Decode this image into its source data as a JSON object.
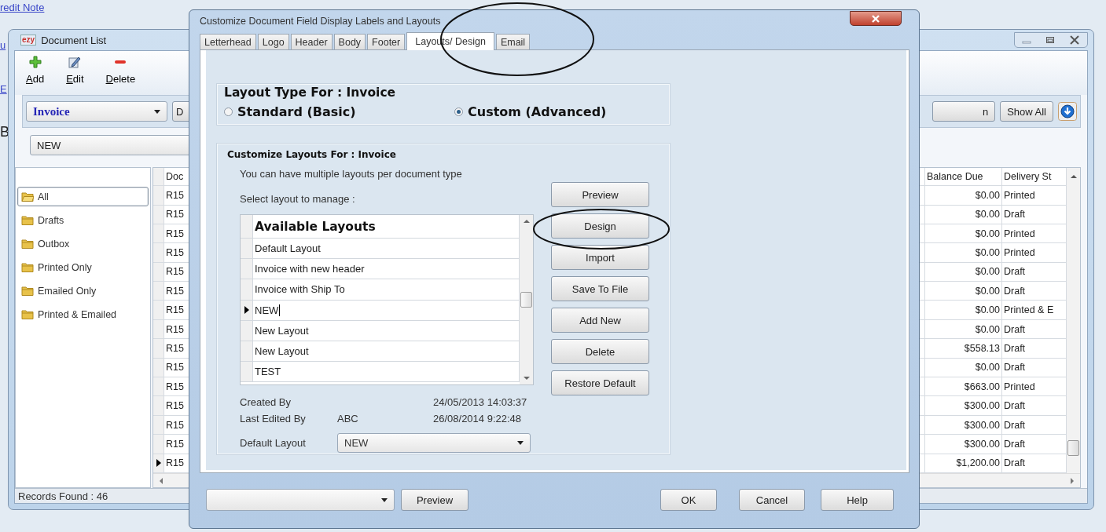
{
  "background_fragments": [
    "redit Note",
    "u",
    "E",
    "B"
  ],
  "document_list": {
    "logo": "ezy",
    "title": "Document List",
    "toolbar": [
      {
        "label": "Add"
      },
      {
        "label": "Edit"
      },
      {
        "label": "Delete"
      }
    ],
    "document_type": "Invoice",
    "left_button": "D",
    "right_button": "n",
    "show_all": "Show All",
    "layout_filter": "NEW",
    "folders": [
      {
        "label": "All",
        "selected": true
      },
      {
        "label": "Drafts",
        "selected": false
      },
      {
        "label": "Outbox",
        "selected": false
      },
      {
        "label": "Printed Only",
        "selected": false
      },
      {
        "label": "Emailed Only",
        "selected": false
      },
      {
        "label": "Printed & Emailed",
        "selected": false
      }
    ],
    "table": {
      "columns": {
        "doc": "Doc",
        "balance_due": "Balance Due",
        "delivery_status": "Delivery St"
      },
      "rows": [
        {
          "doc": "R15",
          "balance_due": "$0.00",
          "delivery_status": "Printed",
          "current": false
        },
        {
          "doc": "R15",
          "balance_due": "$0.00",
          "delivery_status": "Draft",
          "current": false
        },
        {
          "doc": "R15",
          "balance_due": "$0.00",
          "delivery_status": "Printed",
          "current": false
        },
        {
          "doc": "R15",
          "balance_due": "$0.00",
          "delivery_status": "Printed",
          "current": false
        },
        {
          "doc": "R15",
          "balance_due": "$0.00",
          "delivery_status": "Draft",
          "current": false
        },
        {
          "doc": "R15",
          "balance_due": "$0.00",
          "delivery_status": "Draft",
          "current": false
        },
        {
          "doc": "R15",
          "balance_due": "$0.00",
          "delivery_status": "Printed & E",
          "current": false
        },
        {
          "doc": "R15",
          "balance_due": "$0.00",
          "delivery_status": "Draft",
          "current": false
        },
        {
          "doc": "R15",
          "balance_due": "$558.13",
          "delivery_status": "Draft",
          "current": false
        },
        {
          "doc": "R15",
          "balance_due": "$0.00",
          "delivery_status": "Draft",
          "current": false
        },
        {
          "doc": "R15",
          "balance_due": "$663.00",
          "delivery_status": "Printed",
          "current": false
        },
        {
          "doc": "R15",
          "balance_due": "$300.00",
          "delivery_status": "Draft",
          "current": false
        },
        {
          "doc": "R15",
          "balance_due": "$300.00",
          "delivery_status": "Draft",
          "current": false
        },
        {
          "doc": "R15",
          "balance_due": "$300.00",
          "delivery_status": "Draft",
          "current": false
        },
        {
          "doc": "R15",
          "balance_due": "$1,200.00",
          "delivery_status": "Draft",
          "current": true
        }
      ]
    },
    "status": "Records Found : 46"
  },
  "dialog": {
    "title": "Customize Document Field Display Labels and Layouts",
    "tabs": [
      {
        "label": "Letterhead",
        "selected": false
      },
      {
        "label": "Logo",
        "selected": false
      },
      {
        "label": "Header",
        "selected": false
      },
      {
        "label": "Body",
        "selected": false
      },
      {
        "label": "Footer",
        "selected": false
      },
      {
        "label": "Layouts/ Design",
        "selected": true
      },
      {
        "label": "Email",
        "selected": false
      }
    ],
    "layout_type": {
      "legend": "Layout Type For : Invoice",
      "options": [
        {
          "label": "Standard (Basic)",
          "selected": false
        },
        {
          "label": "Custom (Advanced)",
          "selected": true
        }
      ]
    },
    "customize": {
      "legend": "Customize Layouts For : Invoice",
      "hint": "You can have multiple layouts per document type",
      "select_label": "Select layout to manage :",
      "grid_header": "Available Layouts",
      "layouts": [
        {
          "name": "Default Layout",
          "current": false,
          "editing": false
        },
        {
          "name": "Invoice with new header",
          "current": false,
          "editing": false
        },
        {
          "name": "Invoice with Ship To",
          "current": false,
          "editing": false
        },
        {
          "name": "NEW",
          "current": true,
          "editing": true
        },
        {
          "name": "New Layout",
          "current": false,
          "editing": false
        },
        {
          "name": "New Layout",
          "current": false,
          "editing": false
        },
        {
          "name": "TEST",
          "current": false,
          "editing": false
        }
      ],
      "buttons": [
        "Preview",
        "Design",
        "Import",
        "Save To File",
        "Add New",
        "Delete",
        "Restore Default"
      ],
      "created_by": {
        "label": "Created By",
        "date": "24/05/2013 14:03:37"
      },
      "last_edited_by": {
        "label": "Last Edited By",
        "user": "ABC",
        "date": "26/08/2014 9:22:48"
      },
      "default_layout": {
        "label": "Default Layout",
        "value": "NEW"
      }
    },
    "footer": {
      "preview": "Preview",
      "ok": "OK",
      "cancel": "Cancel",
      "help": "Help"
    }
  }
}
